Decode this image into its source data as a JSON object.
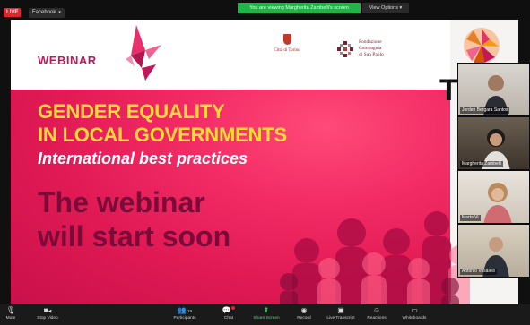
{
  "topbar": {
    "live_badge": "LIVE",
    "platform": "Facebook",
    "viewing_banner": "You are viewing Margherita Zambelli's screen",
    "view_options": "View Options"
  },
  "slide": {
    "webinar_label": "WEBINAR",
    "city_name": "Città di Torino",
    "foundation_name_1": "Fondazione",
    "foundation_name_2": "Compagnia",
    "foundation_name_3": "di San Paolo",
    "brand_letter": "T",
    "headline_1": "GENDER EQUALITY",
    "headline_2": "IN LOCAL GOVERNMENTS",
    "subhead": "International best practices",
    "start_1": "The webinar",
    "start_2": "will start soon",
    "colors": {
      "slide_primary": "#e21a55",
      "headline": "#ffd83a",
      "start_text": "#7a0a38"
    }
  },
  "participants": [
    {
      "name": "Jorden Bergara Santos"
    },
    {
      "name": "Margherita Zambelli"
    },
    {
      "name": "Marta Vi"
    },
    {
      "name": "Antonio Vosalelli"
    }
  ],
  "toolbar": {
    "items": [
      {
        "label": "Mute",
        "icon": "microphone-icon"
      },
      {
        "label": "Stop Video",
        "icon": "video-camera-icon"
      },
      {
        "label": "Participants",
        "icon": "participants-icon",
        "count": "19"
      },
      {
        "label": "Chat",
        "icon": "chat-icon"
      },
      {
        "label": "Share Screen",
        "icon": "share-screen-icon"
      },
      {
        "label": "Record",
        "icon": "record-icon"
      },
      {
        "label": "Live Transcript",
        "icon": "closed-caption-icon"
      },
      {
        "label": "Reactions",
        "icon": "reactions-icon"
      },
      {
        "label": "Whiteboards",
        "icon": "whiteboard-icon"
      }
    ]
  }
}
